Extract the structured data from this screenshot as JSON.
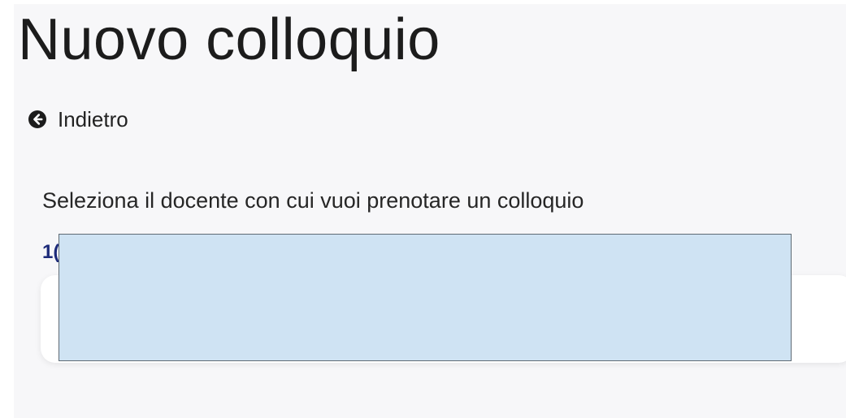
{
  "page": {
    "title": "Nuovo colloquio",
    "back_label": "Indietro",
    "prompt": "Seleziona il docente con cui vuoi prenotare un colloquio",
    "group_label": "1("
  },
  "icons": {
    "back": "arrow-left-circle-icon"
  },
  "colors": {
    "page_background": "#f7f7f9",
    "title_text": "#1c1c1c",
    "group_label": "#1d2b7a",
    "redaction_fill": "#cfe3f3"
  }
}
